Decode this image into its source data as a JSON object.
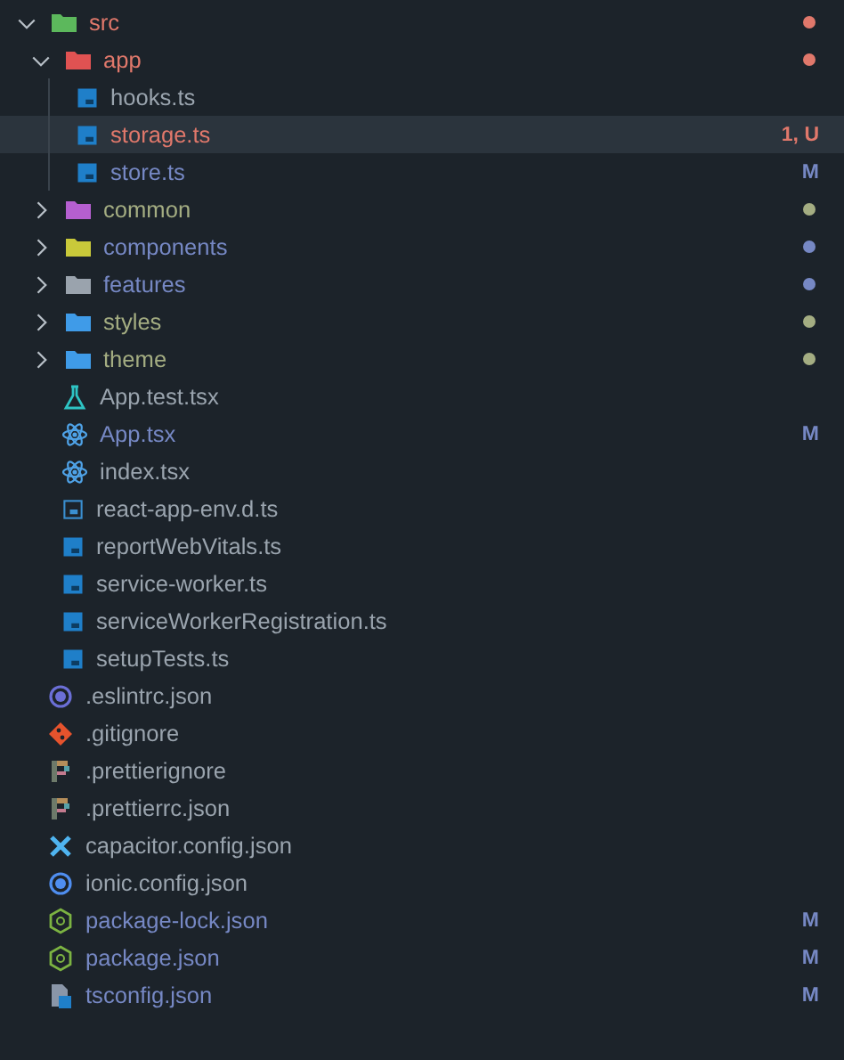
{
  "explorer": {
    "items": [
      {
        "kind": "folder",
        "name": "src",
        "icon": {
          "color": "#5cb85c"
        },
        "color": "#e0786b",
        "expanded": true,
        "selected": false,
        "children": [
          {
            "kind": "folder",
            "name": "app",
            "icon": {
              "color": "#e05252"
            },
            "color": "#e0786b",
            "expanded": true,
            "selected": false,
            "children": [
              {
                "kind": "ts",
                "name": "hooks.ts",
                "selected": false
              },
              {
                "kind": "ts",
                "name": "storage.ts",
                "color": "#e0786b",
                "badge": "1, U",
                "selected": true
              },
              {
                "kind": "ts",
                "name": "store.ts",
                "color": "#7688c4",
                "badge": "M",
                "selected": false
              }
            ]
          },
          {
            "kind": "folder",
            "name": "common",
            "icon": {
              "color": "#b55fd0"
            },
            "color": "#a4ad82",
            "expanded": false,
            "selected": false
          },
          {
            "kind": "folder",
            "name": "components",
            "icon": {
              "color": "#c9c93a"
            },
            "color": "#7688c4",
            "expanded": false,
            "selected": false
          },
          {
            "kind": "folder",
            "name": "features",
            "icon": {
              "color": "#9aa3ad"
            },
            "color": "#7688c4",
            "expanded": false,
            "selected": false
          },
          {
            "kind": "folder",
            "name": "styles",
            "icon": {
              "color": "#3f9be8"
            },
            "color": "#a4ad82",
            "expanded": false,
            "selected": false
          },
          {
            "kind": "folder",
            "name": "theme",
            "icon": {
              "color": "#3f9be8"
            },
            "color": "#a4ad82",
            "expanded": false,
            "selected": false
          },
          {
            "kind": "test",
            "name": "App.test.tsx",
            "selected": false
          },
          {
            "kind": "react",
            "name": "App.tsx",
            "color": "#7688c4",
            "badge": "M",
            "selected": false
          },
          {
            "kind": "react",
            "name": "index.tsx",
            "selected": false
          },
          {
            "kind": "ts-outline",
            "name": "react-app-env.d.ts",
            "selected": false
          },
          {
            "kind": "ts",
            "name": "reportWebVitals.ts",
            "selected": false
          },
          {
            "kind": "ts",
            "name": "service-worker.ts",
            "selected": false
          },
          {
            "kind": "ts",
            "name": "serviceWorkerRegistration.ts",
            "selected": false
          },
          {
            "kind": "ts",
            "name": "setupTests.ts",
            "selected": false
          }
        ]
      },
      {
        "kind": "eslint",
        "name": ".eslintrc.json",
        "selected": false
      },
      {
        "kind": "git",
        "name": ".gitignore",
        "selected": false
      },
      {
        "kind": "prettier",
        "name": ".prettierignore",
        "selected": false
      },
      {
        "kind": "prettier",
        "name": ".prettierrc.json",
        "selected": false
      },
      {
        "kind": "capacitor",
        "name": "capacitor.config.json",
        "selected": false
      },
      {
        "kind": "ionic",
        "name": "ionic.config.json",
        "selected": false
      },
      {
        "kind": "node",
        "name": "package-lock.json",
        "color": "#7688c4",
        "badge": "M",
        "selected": false
      },
      {
        "kind": "node",
        "name": "package.json",
        "color": "#7688c4",
        "badge": "M",
        "selected": false
      },
      {
        "kind": "tsconfig",
        "name": "tsconfig.json",
        "color": "#7688c4",
        "badge": "M",
        "selected": false
      }
    ]
  }
}
